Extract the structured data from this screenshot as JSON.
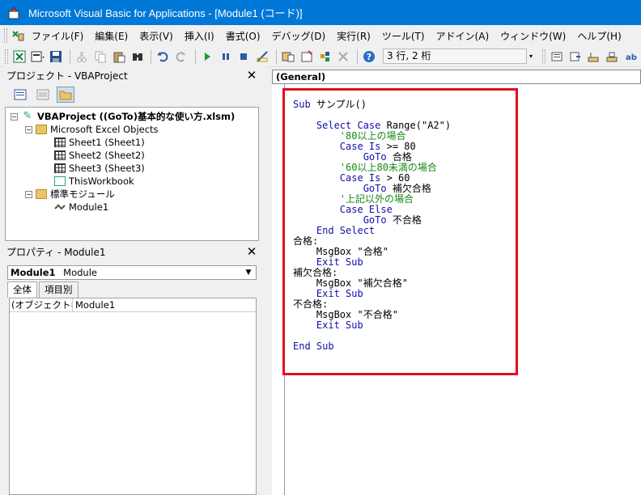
{
  "window": {
    "title": "Microsoft Visual Basic for Applications - [Module1 (コード)]"
  },
  "menu": [
    "ファイル(F)",
    "編集(E)",
    "表示(V)",
    "挿入(I)",
    "書式(O)",
    "デバッグ(D)",
    "実行(R)",
    "ツール(T)",
    "アドイン(A)",
    "ウィンドウ(W)",
    "ヘルプ(H)"
  ],
  "toolbar": {
    "cursor_position": "3 行, 2 桁"
  },
  "project_panel": {
    "title": "プロジェクト - VBAProject",
    "tree": [
      {
        "label": "VBAProject ((GoTo)基本的な使い方.xlsm)",
        "icon": "vbaproject-icon"
      },
      {
        "label": "Microsoft Excel Objects",
        "icon": "folder-icon"
      },
      {
        "label": "Sheet1 (Sheet1)",
        "icon": "sheet-icon"
      },
      {
        "label": "Sheet2 (Sheet2)",
        "icon": "sheet-icon"
      },
      {
        "label": "Sheet3 (Sheet3)",
        "icon": "sheet-icon"
      },
      {
        "label": "ThisWorkbook",
        "icon": "workbook-icon"
      },
      {
        "label": "標準モジュール",
        "icon": "folder-icon"
      },
      {
        "label": "Module1",
        "icon": "module-icon"
      }
    ]
  },
  "properties_panel": {
    "title": "プロパティ - Module1",
    "object_name": "Module1",
    "object_type": "Module",
    "tabs": [
      "全体",
      "項目別"
    ],
    "rows": [
      {
        "name": "(オブジェクト名)",
        "value": "Module1"
      }
    ]
  },
  "code_window": {
    "object_combo": "(General)",
    "lines": [
      {
        "parts": [
          {
            "t": "Sub",
            "c": "kw"
          },
          {
            "t": " サンプル()",
            "c": "txt"
          }
        ]
      },
      {
        "parts": []
      },
      {
        "parts": [
          {
            "t": "    ",
            "c": "txt"
          },
          {
            "t": "Select Case",
            "c": "kw"
          },
          {
            "t": " Range(\"A2\")",
            "c": "txt"
          }
        ]
      },
      {
        "parts": [
          {
            "t": "        '80以上の場合",
            "c": "cm"
          }
        ]
      },
      {
        "parts": [
          {
            "t": "        ",
            "c": "txt"
          },
          {
            "t": "Case Is",
            "c": "kw"
          },
          {
            "t": " >= 80",
            "c": "txt"
          }
        ]
      },
      {
        "parts": [
          {
            "t": "            ",
            "c": "txt"
          },
          {
            "t": "GoTo",
            "c": "kw"
          },
          {
            "t": " 合格",
            "c": "txt"
          }
        ]
      },
      {
        "parts": [
          {
            "t": "        '60以上80未満の場合",
            "c": "cm"
          }
        ]
      },
      {
        "parts": [
          {
            "t": "        ",
            "c": "txt"
          },
          {
            "t": "Case Is",
            "c": "kw"
          },
          {
            "t": " > 60",
            "c": "txt"
          }
        ]
      },
      {
        "parts": [
          {
            "t": "            ",
            "c": "txt"
          },
          {
            "t": "GoTo",
            "c": "kw"
          },
          {
            "t": " 補欠合格",
            "c": "txt"
          }
        ]
      },
      {
        "parts": [
          {
            "t": "        '上記以外の場合",
            "c": "cm"
          }
        ]
      },
      {
        "parts": [
          {
            "t": "        ",
            "c": "txt"
          },
          {
            "t": "Case Else",
            "c": "kw"
          }
        ]
      },
      {
        "parts": [
          {
            "t": "            ",
            "c": "txt"
          },
          {
            "t": "GoTo",
            "c": "kw"
          },
          {
            "t": " 不合格",
            "c": "txt"
          }
        ]
      },
      {
        "parts": [
          {
            "t": "    ",
            "c": "txt"
          },
          {
            "t": "End Select",
            "c": "kw"
          }
        ]
      },
      {
        "parts": [
          {
            "t": "合格:",
            "c": "txt"
          }
        ]
      },
      {
        "parts": [
          {
            "t": "    MsgBox \"合格\"",
            "c": "txt"
          }
        ]
      },
      {
        "parts": [
          {
            "t": "    ",
            "c": "txt"
          },
          {
            "t": "Exit Sub",
            "c": "kw"
          }
        ]
      },
      {
        "parts": [
          {
            "t": "補欠合格:",
            "c": "txt"
          }
        ]
      },
      {
        "parts": [
          {
            "t": "    MsgBox \"補欠合格\"",
            "c": "txt"
          }
        ]
      },
      {
        "parts": [
          {
            "t": "    ",
            "c": "txt"
          },
          {
            "t": "Exit Sub",
            "c": "kw"
          }
        ]
      },
      {
        "parts": [
          {
            "t": "不合格:",
            "c": "txt"
          }
        ]
      },
      {
        "parts": [
          {
            "t": "    MsgBox \"不合格\"",
            "c": "txt"
          }
        ]
      },
      {
        "parts": [
          {
            "t": "    ",
            "c": "txt"
          },
          {
            "t": "Exit Sub",
            "c": "kw"
          }
        ]
      },
      {
        "parts": []
      },
      {
        "parts": [
          {
            "t": "End Sub",
            "c": "kw"
          }
        ]
      }
    ]
  },
  "colors": {
    "titlebar": "#0078d7",
    "keyword": "#1010a8",
    "comment": "#148a14",
    "highlight": "#e0101a"
  }
}
